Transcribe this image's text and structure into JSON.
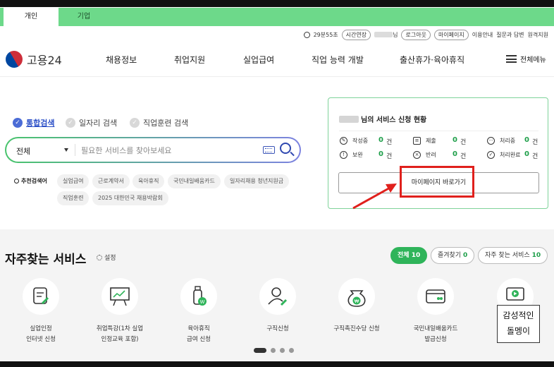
{
  "user_tabs": [
    "개인",
    "기업"
  ],
  "util": {
    "timer": "29분55초",
    "extend": "시간연장",
    "name_suffix": "님",
    "logout": "로그아웃",
    "mypage": "마이페이지",
    "guide": "이용안내",
    "faq": "질문과 답변",
    "remote": "원격지원"
  },
  "logo": {
    "text": "고용24"
  },
  "gnb": [
    "채용정보",
    "취업지원",
    "실업급여",
    "직업 능력 개발",
    "출산휴가·육아휴직"
  ],
  "all_menu": "전체메뉴",
  "search": {
    "types": [
      "통합검색",
      "일자리 검색",
      "직업훈련 검색"
    ],
    "select_value": "전체",
    "placeholder": "필요한 서비스를 찾아보세요"
  },
  "recommend": {
    "label": "추천검색어",
    "keywords": [
      "실업급여",
      "근로계약서",
      "육아휴직",
      "국민내일배움카드",
      "일자리채용 청년지원금",
      "직업훈련",
      "2025 대한민국 채용박람회"
    ]
  },
  "status_panel": {
    "title": "님의 서비스 신청 현황",
    "items": [
      {
        "label": "작성중",
        "count": "0",
        "unit": "건"
      },
      {
        "label": "제출",
        "count": "0",
        "unit": "건"
      },
      {
        "label": "처리중",
        "count": "0",
        "unit": "건"
      },
      {
        "label": "보완",
        "count": "0",
        "unit": "건"
      },
      {
        "label": "반려",
        "count": "0",
        "unit": "건"
      },
      {
        "label": "처리완료",
        "count": "0",
        "unit": "건"
      }
    ],
    "mypage_button": "마이페이지 바로가기"
  },
  "services": {
    "title": "자주찾는 서비스",
    "setting": "설정",
    "filters": [
      {
        "label": "전체",
        "count": "10"
      },
      {
        "label": "즐겨찾기",
        "count": "0"
      },
      {
        "label": "자주 찾는 서비스",
        "count": "10"
      }
    ],
    "items": [
      "실업인정\n인터넷 신청",
      "취업특강(1차 실업\n인정교육 포함)",
      "육아휴직\n급여 신청",
      "구직신청",
      "구직촉진수당 신청",
      "국민내일배움카드\n발급신청"
    ]
  },
  "watermark": {
    "line1": "감성적인",
    "line2": "돌멩이"
  }
}
